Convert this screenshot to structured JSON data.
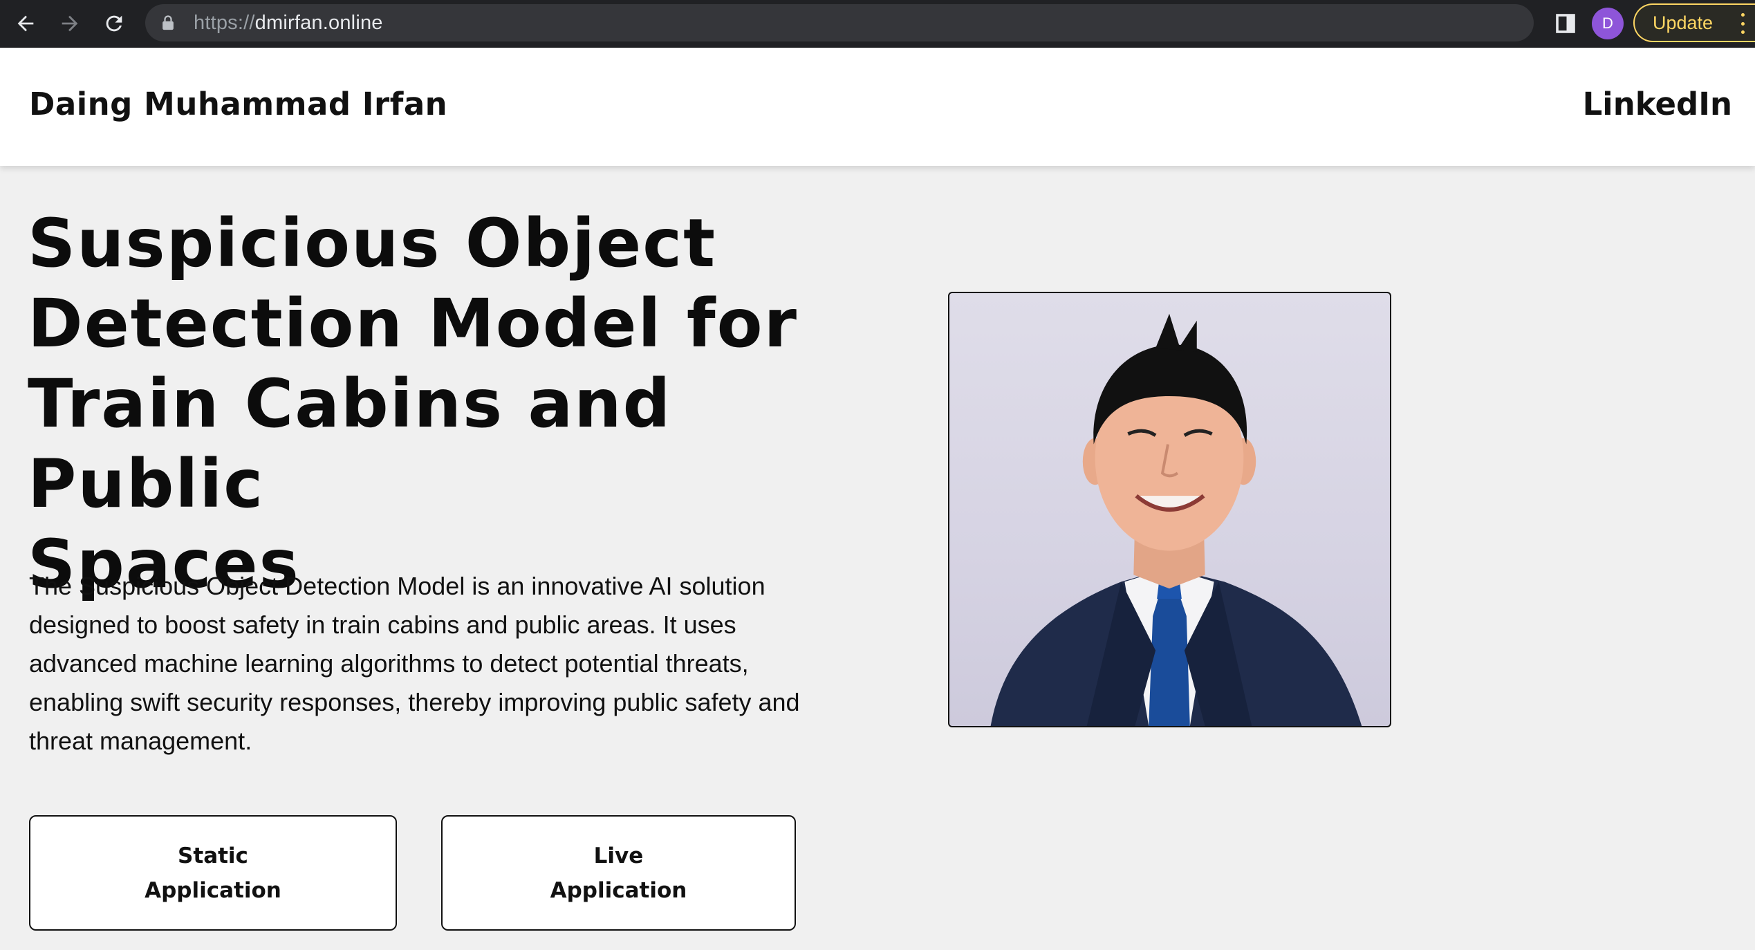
{
  "browser": {
    "url_scheme": "https://",
    "url_host": "dmirfan.online",
    "avatar_letter": "D",
    "update_label": "Update",
    "icons": [
      "back-arrow-icon",
      "forward-arrow-icon",
      "reload-icon",
      "lock-icon",
      "sidebar-icon",
      "more-vert-icon"
    ]
  },
  "header": {
    "brand": "Daing Muhammad Irfan",
    "nav_link": "LinkedIn"
  },
  "hero": {
    "title_lines": [
      "Suspicious Object",
      "Detection Model for",
      "Train Cabins and Public",
      "Spaces"
    ],
    "description": "The Suspicious Object Detection Model is an innovative AI solution designed to boost safety in train cabins and public areas. It uses advanced machine learning algorithms to detect potential threats, enabling swift security responses, thereby improving public safety and threat management.",
    "buttons": {
      "static": [
        "Static",
        "Application"
      ],
      "live": [
        "Live",
        "Application"
      ]
    }
  },
  "colors": {
    "chrome_bg": "#202124",
    "address_bg": "#35363a",
    "update_accent": "#fdd663",
    "avatar_bg": "#8e55d9",
    "page_bg": "#f0f0f0",
    "header_bg": "#ffffff",
    "text": "#111111"
  }
}
